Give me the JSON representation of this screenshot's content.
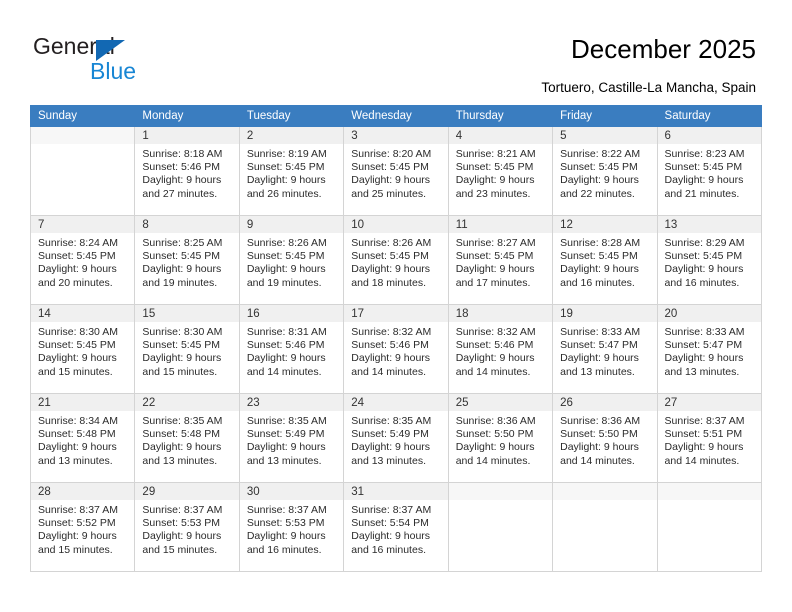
{
  "brand": {
    "name_part1": "General",
    "name_part2": "Blue",
    "primary_color": "#1268b3",
    "accent_color": "#1886d4"
  },
  "header": {
    "title": "December 2025",
    "location": "Tortuero, Castille-La Mancha, Spain"
  },
  "calendar": {
    "header_color": "#3a7dc0",
    "weekday_headers": [
      "Sunday",
      "Monday",
      "Tuesday",
      "Wednesday",
      "Thursday",
      "Friday",
      "Saturday"
    ],
    "labels": {
      "sunrise": "Sunrise:",
      "sunset": "Sunset:",
      "daylight": "Daylight:"
    },
    "weeks": [
      [
        {
          "day": "",
          "sunrise": "",
          "sunset": "",
          "daylight": ""
        },
        {
          "day": "1",
          "sunrise": "Sunrise: 8:18 AM",
          "sunset": "Sunset: 5:46 PM",
          "daylight": "Daylight: 9 hours and 27 minutes."
        },
        {
          "day": "2",
          "sunrise": "Sunrise: 8:19 AM",
          "sunset": "Sunset: 5:45 PM",
          "daylight": "Daylight: 9 hours and 26 minutes."
        },
        {
          "day": "3",
          "sunrise": "Sunrise: 8:20 AM",
          "sunset": "Sunset: 5:45 PM",
          "daylight": "Daylight: 9 hours and 25 minutes."
        },
        {
          "day": "4",
          "sunrise": "Sunrise: 8:21 AM",
          "sunset": "Sunset: 5:45 PM",
          "daylight": "Daylight: 9 hours and 23 minutes."
        },
        {
          "day": "5",
          "sunrise": "Sunrise: 8:22 AM",
          "sunset": "Sunset: 5:45 PM",
          "daylight": "Daylight: 9 hours and 22 minutes."
        },
        {
          "day": "6",
          "sunrise": "Sunrise: 8:23 AM",
          "sunset": "Sunset: 5:45 PM",
          "daylight": "Daylight: 9 hours and 21 minutes."
        }
      ],
      [
        {
          "day": "7",
          "sunrise": "Sunrise: 8:24 AM",
          "sunset": "Sunset: 5:45 PM",
          "daylight": "Daylight: 9 hours and 20 minutes."
        },
        {
          "day": "8",
          "sunrise": "Sunrise: 8:25 AM",
          "sunset": "Sunset: 5:45 PM",
          "daylight": "Daylight: 9 hours and 19 minutes."
        },
        {
          "day": "9",
          "sunrise": "Sunrise: 8:26 AM",
          "sunset": "Sunset: 5:45 PM",
          "daylight": "Daylight: 9 hours and 19 minutes."
        },
        {
          "day": "10",
          "sunrise": "Sunrise: 8:26 AM",
          "sunset": "Sunset: 5:45 PM",
          "daylight": "Daylight: 9 hours and 18 minutes."
        },
        {
          "day": "11",
          "sunrise": "Sunrise: 8:27 AM",
          "sunset": "Sunset: 5:45 PM",
          "daylight": "Daylight: 9 hours and 17 minutes."
        },
        {
          "day": "12",
          "sunrise": "Sunrise: 8:28 AM",
          "sunset": "Sunset: 5:45 PM",
          "daylight": "Daylight: 9 hours and 16 minutes."
        },
        {
          "day": "13",
          "sunrise": "Sunrise: 8:29 AM",
          "sunset": "Sunset: 5:45 PM",
          "daylight": "Daylight: 9 hours and 16 minutes."
        }
      ],
      [
        {
          "day": "14",
          "sunrise": "Sunrise: 8:30 AM",
          "sunset": "Sunset: 5:45 PM",
          "daylight": "Daylight: 9 hours and 15 minutes."
        },
        {
          "day": "15",
          "sunrise": "Sunrise: 8:30 AM",
          "sunset": "Sunset: 5:45 PM",
          "daylight": "Daylight: 9 hours and 15 minutes."
        },
        {
          "day": "16",
          "sunrise": "Sunrise: 8:31 AM",
          "sunset": "Sunset: 5:46 PM",
          "daylight": "Daylight: 9 hours and 14 minutes."
        },
        {
          "day": "17",
          "sunrise": "Sunrise: 8:32 AM",
          "sunset": "Sunset: 5:46 PM",
          "daylight": "Daylight: 9 hours and 14 minutes."
        },
        {
          "day": "18",
          "sunrise": "Sunrise: 8:32 AM",
          "sunset": "Sunset: 5:46 PM",
          "daylight": "Daylight: 9 hours and 14 minutes."
        },
        {
          "day": "19",
          "sunrise": "Sunrise: 8:33 AM",
          "sunset": "Sunset: 5:47 PM",
          "daylight": "Daylight: 9 hours and 13 minutes."
        },
        {
          "day": "20",
          "sunrise": "Sunrise: 8:33 AM",
          "sunset": "Sunset: 5:47 PM",
          "daylight": "Daylight: 9 hours and 13 minutes."
        }
      ],
      [
        {
          "day": "21",
          "sunrise": "Sunrise: 8:34 AM",
          "sunset": "Sunset: 5:48 PM",
          "daylight": "Daylight: 9 hours and 13 minutes."
        },
        {
          "day": "22",
          "sunrise": "Sunrise: 8:35 AM",
          "sunset": "Sunset: 5:48 PM",
          "daylight": "Daylight: 9 hours and 13 minutes."
        },
        {
          "day": "23",
          "sunrise": "Sunrise: 8:35 AM",
          "sunset": "Sunset: 5:49 PM",
          "daylight": "Daylight: 9 hours and 13 minutes."
        },
        {
          "day": "24",
          "sunrise": "Sunrise: 8:35 AM",
          "sunset": "Sunset: 5:49 PM",
          "daylight": "Daylight: 9 hours and 13 minutes."
        },
        {
          "day": "25",
          "sunrise": "Sunrise: 8:36 AM",
          "sunset": "Sunset: 5:50 PM",
          "daylight": "Daylight: 9 hours and 14 minutes."
        },
        {
          "day": "26",
          "sunrise": "Sunrise: 8:36 AM",
          "sunset": "Sunset: 5:50 PM",
          "daylight": "Daylight: 9 hours and 14 minutes."
        },
        {
          "day": "27",
          "sunrise": "Sunrise: 8:37 AM",
          "sunset": "Sunset: 5:51 PM",
          "daylight": "Daylight: 9 hours and 14 minutes."
        }
      ],
      [
        {
          "day": "28",
          "sunrise": "Sunrise: 8:37 AM",
          "sunset": "Sunset: 5:52 PM",
          "daylight": "Daylight: 9 hours and 15 minutes."
        },
        {
          "day": "29",
          "sunrise": "Sunrise: 8:37 AM",
          "sunset": "Sunset: 5:53 PM",
          "daylight": "Daylight: 9 hours and 15 minutes."
        },
        {
          "day": "30",
          "sunrise": "Sunrise: 8:37 AM",
          "sunset": "Sunset: 5:53 PM",
          "daylight": "Daylight: 9 hours and 16 minutes."
        },
        {
          "day": "31",
          "sunrise": "Sunrise: 8:37 AM",
          "sunset": "Sunset: 5:54 PM",
          "daylight": "Daylight: 9 hours and 16 minutes."
        },
        {
          "day": "",
          "sunrise": "",
          "sunset": "",
          "daylight": ""
        },
        {
          "day": "",
          "sunrise": "",
          "sunset": "",
          "daylight": ""
        },
        {
          "day": "",
          "sunrise": "",
          "sunset": "",
          "daylight": ""
        }
      ]
    ]
  }
}
